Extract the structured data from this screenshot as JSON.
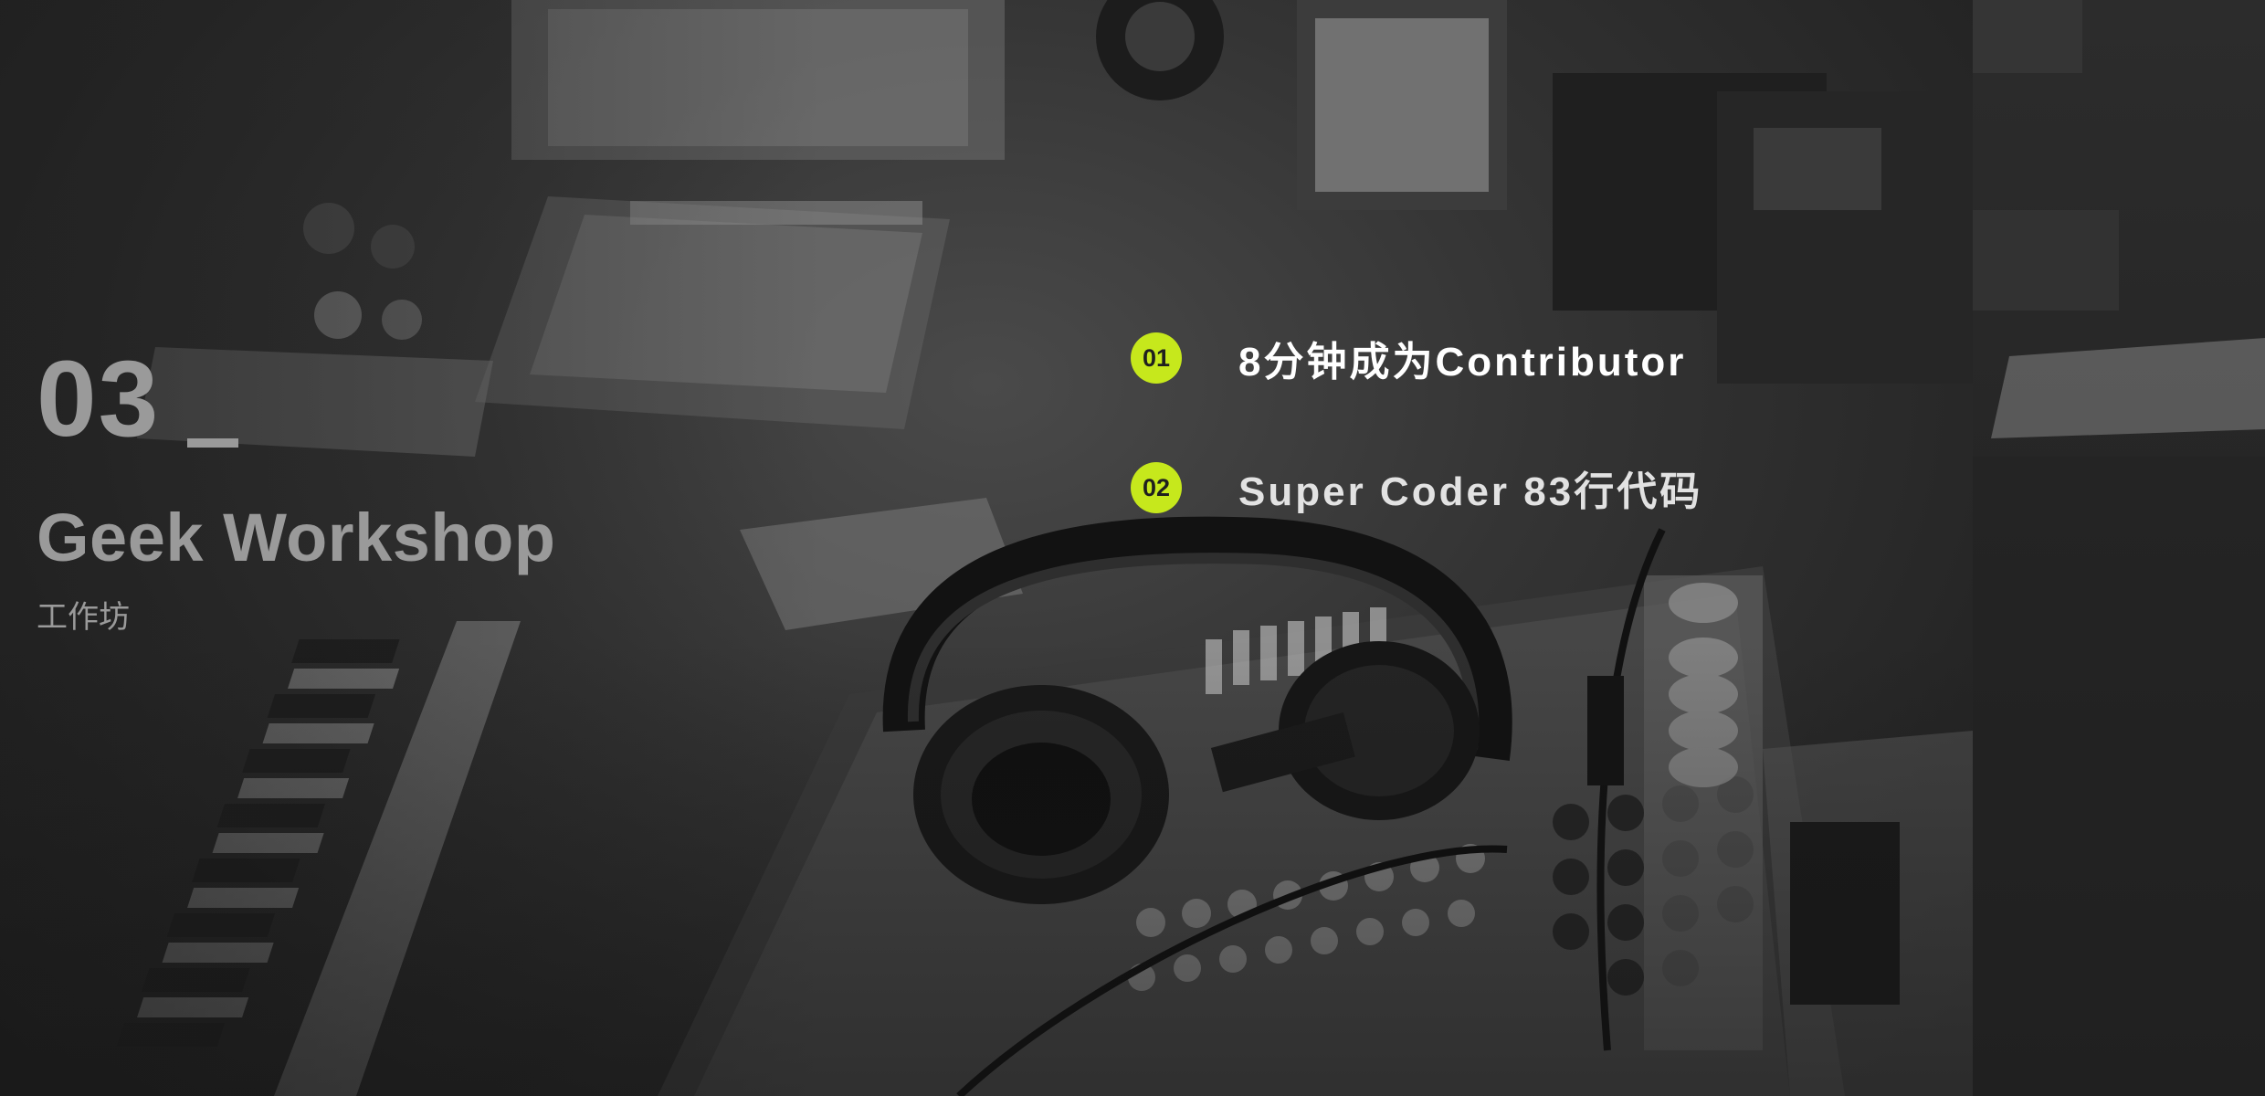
{
  "section": {
    "number": "03",
    "title": "Geek Workshop",
    "subtitle": "工作坊"
  },
  "agenda": {
    "items": [
      {
        "index": "01",
        "label": "8分钟成为Contributor"
      },
      {
        "index": "02",
        "label": "Super Coder 83行代码"
      }
    ]
  },
  "colors": {
    "accent": "#c6e81c",
    "heading_gray": "#9a9a9a",
    "background": "#2a2a2a",
    "text_primary": "#ffffff"
  },
  "background_image": {
    "subject": "studio-mixer-and-headphones-photo",
    "style": "grayscale"
  }
}
